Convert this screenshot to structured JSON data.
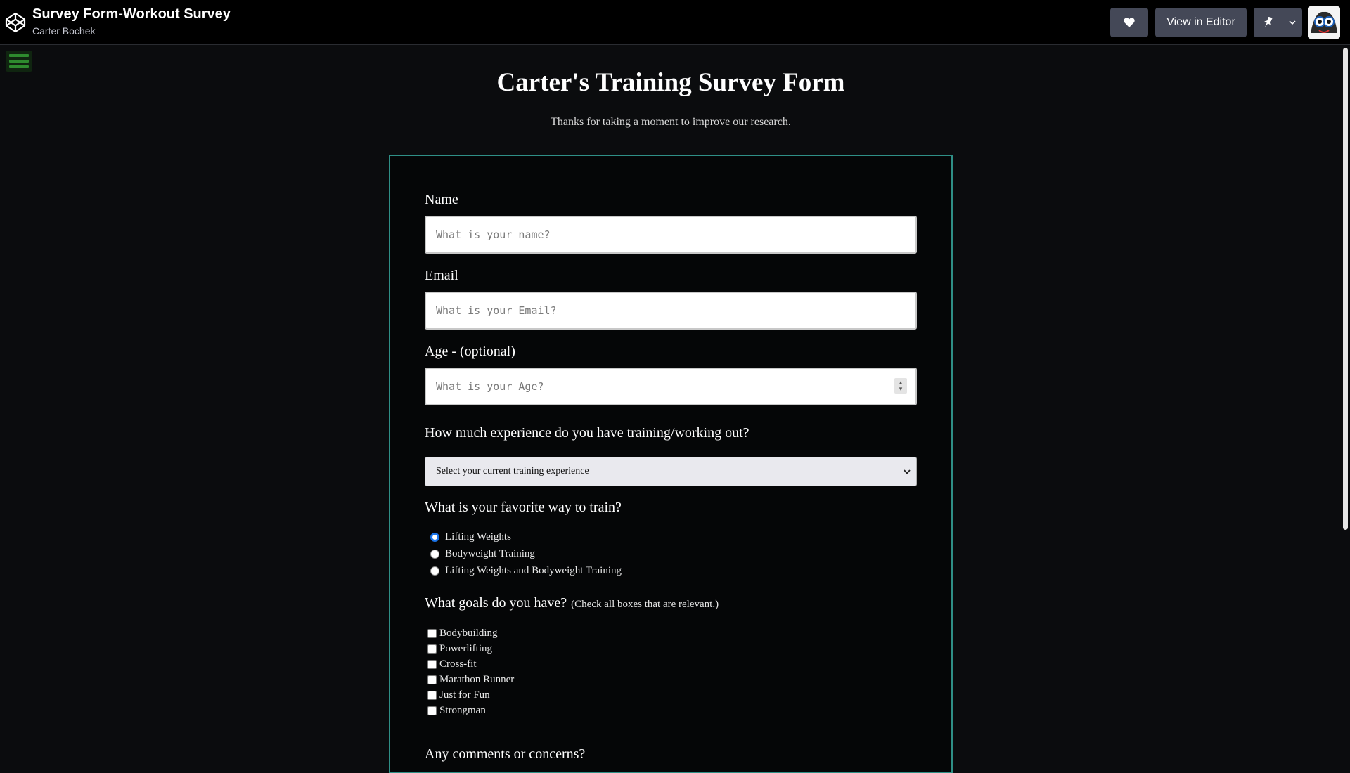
{
  "header": {
    "pen_title": "Survey Form-Workout Survey",
    "author": "Carter Bochek",
    "view_in_editor": "View in Editor",
    "icons": [
      "codepen-logo-icon",
      "heart-icon",
      "pin-icon",
      "chevron-down-icon",
      "avatar"
    ]
  },
  "page": {
    "title": "Carter's Training Survey Form",
    "description": "Thanks for taking a moment to improve our research."
  },
  "form": {
    "name": {
      "label": "Name",
      "placeholder": "What is your name?"
    },
    "email": {
      "label": "Email",
      "placeholder": "What is your Email?"
    },
    "age": {
      "label": "Age - (optional)",
      "placeholder": "What is your Age?"
    },
    "experience": {
      "label": "How much experience do you have training/working out?",
      "selected": "Select your current training experience"
    },
    "favorite": {
      "label": "What is your favorite way to train?",
      "options": [
        "Lifting Weights",
        "Bodyweight Training",
        "Lifting Weights and Bodyweight Training"
      ],
      "selected_index": 0
    },
    "goals": {
      "label": "What goals do you have?",
      "hint": "(Check all boxes that are relevant.)",
      "options": [
        "Bodybuilding",
        "Powerlifting",
        "Cross-fit",
        "Marathon Runner",
        "Just for Fun",
        "Strongman"
      ]
    },
    "comments": {
      "label": "Any comments or concerns?"
    }
  },
  "colors": {
    "form_border": "#2f8f86",
    "radio_selected": "#1a73e8",
    "menu_icon": "#2e8b2e"
  }
}
